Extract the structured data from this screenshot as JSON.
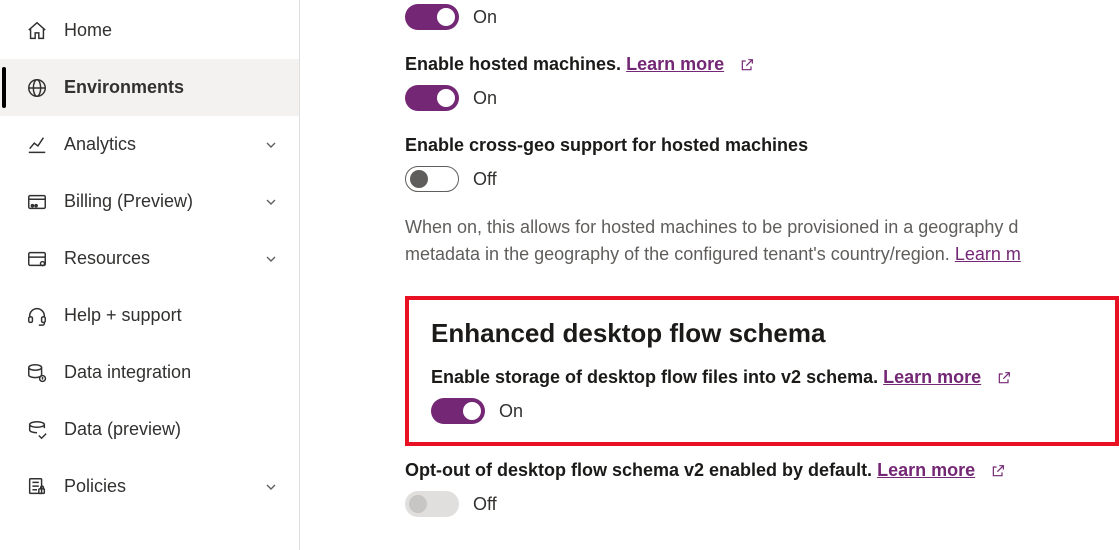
{
  "sidebar": {
    "items": [
      {
        "label": "Home"
      },
      {
        "label": "Environments"
      },
      {
        "label": "Analytics"
      },
      {
        "label": "Billing (Preview)"
      },
      {
        "label": "Resources"
      },
      {
        "label": "Help + support"
      },
      {
        "label": "Data integration"
      },
      {
        "label": "Data (preview)"
      },
      {
        "label": "Policies"
      }
    ]
  },
  "settings": {
    "s0_state": "On",
    "s1_title": "Enable hosted machines.",
    "s1_link": "Learn more",
    "s1_state": "On",
    "s2_title": "Enable cross-geo support for hosted machines",
    "s2_state": "Off",
    "s2_desc_a": "When on, this allows for hosted machines to be provisioned in a geography d",
    "s2_desc_b": "metadata in the geography of the configured tenant's country/region. ",
    "s2_desc_link": "Learn m",
    "section_heading": "Enhanced desktop flow schema",
    "s3_title": "Enable storage of desktop flow files into v2 schema.",
    "s3_link": "Learn more",
    "s3_state": "On",
    "s4_title": "Opt-out of desktop flow schema v2 enabled by default.",
    "s4_link": "Learn more",
    "s4_state": "Off"
  }
}
